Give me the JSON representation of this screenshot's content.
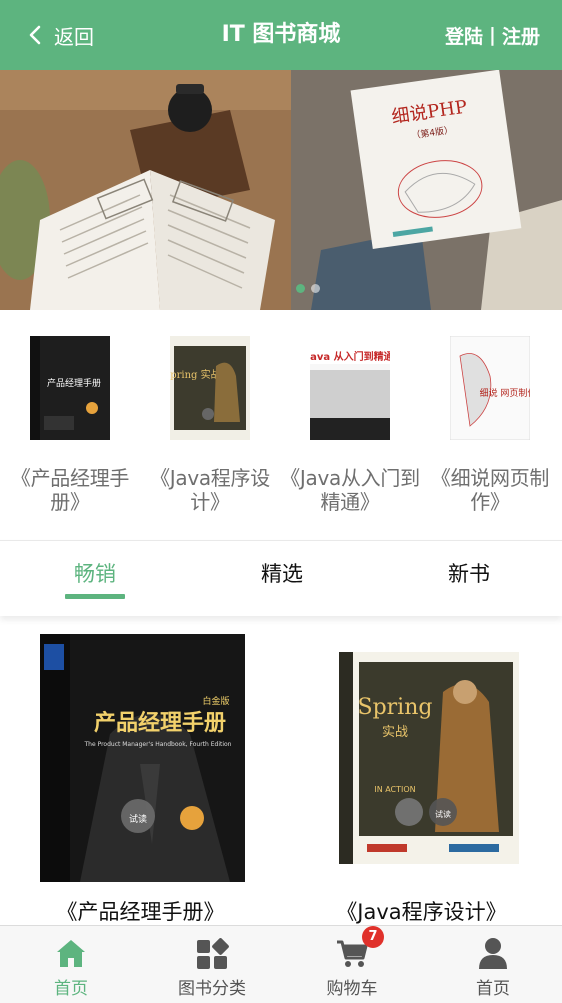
{
  "header": {
    "back_label": "返回",
    "title": "IT 图书商城",
    "login_label": "登陆",
    "separator": "|",
    "register_label": "注册"
  },
  "banner": {
    "slides": [
      {
        "book_title": "细说PHP",
        "edition": "（第4版）"
      }
    ],
    "dot_count": 2,
    "active_dot": 0
  },
  "featured": [
    {
      "label": "《产品经理手册》",
      "cover_color": "#1c1c1c",
      "cover_text": "产品经理手册"
    },
    {
      "label": "《Java程序设计》",
      "cover_color": "#3a3a2c",
      "cover_text": "Spring 实战"
    },
    {
      "label": "《Java从入门到精通》",
      "cover_color": "#c62828",
      "cover_text": "Java 从入门到精通"
    },
    {
      "label": "《细说网页制作》",
      "cover_color": "#f2f2f2",
      "cover_text": "细说 网页制作"
    }
  ],
  "tabs": [
    {
      "label": "畅销",
      "active": true
    },
    {
      "label": "精选",
      "active": false
    },
    {
      "label": "新书",
      "active": false
    }
  ],
  "products": [
    {
      "title": "《产品经理手册》",
      "cover_title": "产品经理手册",
      "cover_subtitle": "The Product Manager's Handbook, Fourth Edition",
      "cover_badge": "白金版",
      "read_label": "试读"
    },
    {
      "title": "《Java程序设计》",
      "cover_title": "Spring",
      "cover_subtitle": "实战",
      "cover_badge": "IN ACTION",
      "read_label": "试读"
    }
  ],
  "tabbar": [
    {
      "label": "首页",
      "icon": "home-icon",
      "active": true
    },
    {
      "label": "图书分类",
      "icon": "category-icon",
      "active": false
    },
    {
      "label": "购物车",
      "icon": "cart-icon",
      "active": false,
      "badge": "7"
    },
    {
      "label": "首页",
      "icon": "user-icon",
      "active": false
    }
  ],
  "colors": {
    "brand": "#5db47f",
    "badge": "#e0312b"
  }
}
